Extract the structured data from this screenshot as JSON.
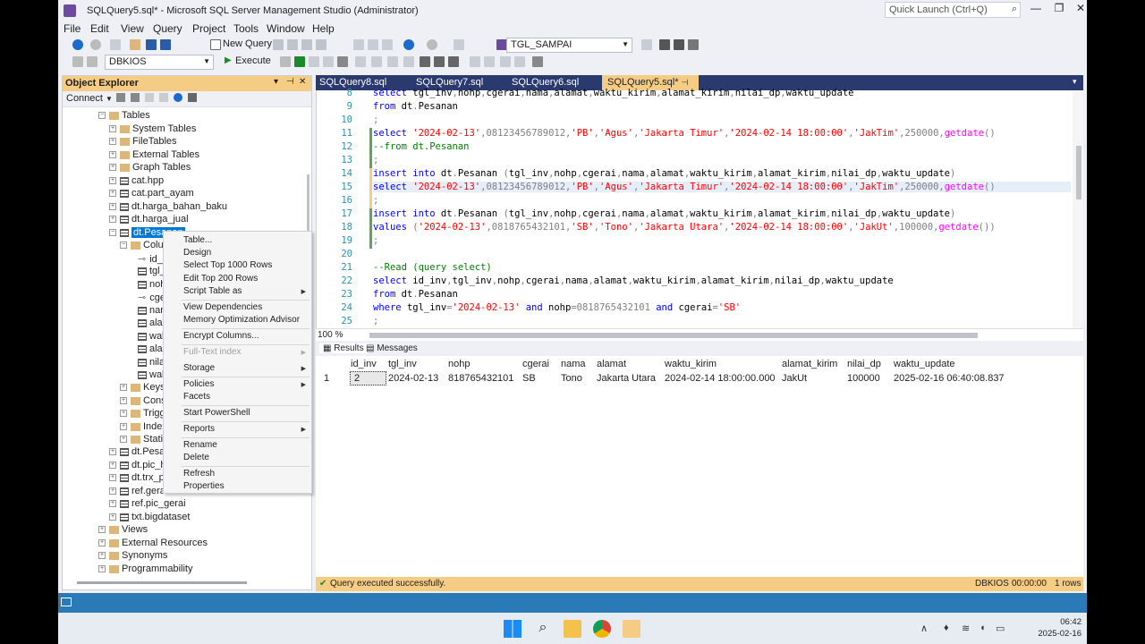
{
  "window": {
    "title": "SQLQuery5.sql* - Microsoft SQL Server Management Studio (Administrator)",
    "quick_launch_placeholder": "Quick Launch (Ctrl+Q)"
  },
  "menu": [
    "File",
    "Edit",
    "View",
    "Query",
    "Project",
    "Tools",
    "Window",
    "Help"
  ],
  "toolbar": {
    "new_query": "New Query",
    "object_combo": "TGL_SAMPAI",
    "database_combo": "DBKIOS",
    "execute": "Execute"
  },
  "object_explorer": {
    "title": "Object Explorer",
    "connect": "Connect",
    "nodes": {
      "tables": "Tables",
      "system_tables": "System Tables",
      "filetables": "FileTables",
      "external_tables": "External Tables",
      "graph_tables": "Graph Tables",
      "cat_hpp": "cat.hpp",
      "cat_part_ayam": "cat.part_ayam",
      "dt_harga_bahan_baku": "dt.harga_bahan_baku",
      "dt_harga_jual": "dt.harga_jual",
      "dt_pesanan": "dt.Pesanan",
      "columns": "Colum",
      "col1": "id_in",
      "col2": "tgl_i",
      "col3": "nohp",
      "col4": "cger",
      "col5": "nam",
      "col6": "alan",
      "col7": "wak",
      "col8": "alan",
      "col9": "nilai",
      "col10": "wak",
      "keys": "Keys",
      "constraints": "Const",
      "triggers": "Trigge",
      "indexes": "Indexe",
      "statistics": "Statist",
      "dt_pesanan2": "dt.Pesan",
      "dt_pic_his": "dt.pic_his",
      "dt_trx_pe": "dt.trx_pe",
      "ref_gerai": "ref.gerai",
      "ref_pic_gerai": "ref.pic_gerai",
      "txt_bigdataset": "txt.bigdataset",
      "views": "Views",
      "external_resources": "External Resources",
      "synonyms": "Synonyms",
      "programmability": "Programmability"
    }
  },
  "context_menu": {
    "table": "Table...",
    "design": "Design",
    "select_top": "Select Top 1000 Rows",
    "edit_top": "Edit Top 200 Rows",
    "script_table": "Script Table as",
    "view_deps": "View Dependencies",
    "mem_opt": "Memory Optimization Advisor",
    "encrypt": "Encrypt Columns...",
    "fulltext": "Full-Text index",
    "storage": "Storage",
    "policies": "Policies",
    "facets": "Facets",
    "powershell": "Start PowerShell",
    "reports": "Reports",
    "rename": "Rename",
    "delete": "Delete",
    "refresh": "Refresh",
    "properties": "Properties"
  },
  "tabs": [
    "SQLQuery8.sql",
    "SQLQuery7.sql",
    "SQLQuery6.sql",
    "SQLQuery5.sql*"
  ],
  "editor": {
    "lines": [
      {
        "n": "8",
        "code": "select tgl_inv,nohp,cgerai,nama,alamat,waktu_kirim,alamat_kirim,nilai_dp,waktu_update"
      },
      {
        "n": "9",
        "code": "from dt.Pesanan"
      },
      {
        "n": "10",
        "code": ";"
      },
      {
        "n": "11",
        "code": "select '2024-02-13',08123456789012,'PB','Agus','Jakarta Timur','2024-02-14 18:00:00','JakTim',250000,getdate()"
      },
      {
        "n": "12",
        "code": "--from dt.Pesanan"
      },
      {
        "n": "13",
        "code": ";"
      },
      {
        "n": "14",
        "code": "insert into dt.Pesanan (tgl_inv,nohp,cgerai,nama,alamat,waktu_kirim,alamat_kirim,nilai_dp,waktu_update)"
      },
      {
        "n": "15",
        "code": "select '2024-02-13',08123456789012,'PB','Agus','Jakarta Timur','2024-02-14 18:00:00','JakTim',250000,getdate()"
      },
      {
        "n": "16",
        "code": ";"
      },
      {
        "n": "17",
        "code": "insert into dt.Pesanan (tgl_inv,nohp,cgerai,nama,alamat,waktu_kirim,alamat_kirim,nilai_dp,waktu_update)"
      },
      {
        "n": "18",
        "code": "values ('2024-02-13',0818765432101,'SB','Tono','Jakarta Utara','2024-02-14 18:00:00','JakUt',100000,getdate())"
      },
      {
        "n": "19",
        "code": ";"
      },
      {
        "n": "20",
        "code": ""
      },
      {
        "n": "21",
        "code": "--Read (query select)"
      },
      {
        "n": "22",
        "code": "select id_inv,tgl_inv,nohp,cgerai,nama,alamat,waktu_kirim,alamat_kirim,nilai_dp,waktu_update"
      },
      {
        "n": "23",
        "code": "from dt.Pesanan"
      },
      {
        "n": "24",
        "code": "where tgl_inv='2024-02-13' and nohp=0818765432101 and cgerai='SB'"
      },
      {
        "n": "25",
        "code": ";"
      }
    ],
    "zoom": "100 %"
  },
  "results": {
    "tab_results": "Results",
    "tab_messages": "Messages",
    "columns": [
      "id_inv",
      "tgl_inv",
      "nohp",
      "cgerai",
      "nama",
      "alamat",
      "waktu_kirim",
      "alamat_kirim",
      "nilai_dp",
      "waktu_update"
    ],
    "rows": [
      {
        "num": "1",
        "cells": [
          "2",
          "2024-02-13",
          "818765432101",
          "SB",
          "Tono",
          "Jakarta Utara",
          "2024-02-14 18:00:00.000",
          "JakUt",
          "100000",
          "2025-02-16 06:40:08.837"
        ]
      }
    ]
  },
  "status": {
    "message": "Query executed successfully.",
    "db": "DBKIOS",
    "time": "00:00:00",
    "rows": "1 rows"
  },
  "taskbar": {
    "time": "06:42",
    "date": "2025-02-16"
  },
  "colors": {
    "accent_gold": "#f5cc84",
    "tab_dark": "#2b3a6e",
    "selection": "#0078d7",
    "keyword": "#0000ff",
    "string": "#ff0000",
    "comment": "#008000",
    "function": "#ff00ff"
  }
}
